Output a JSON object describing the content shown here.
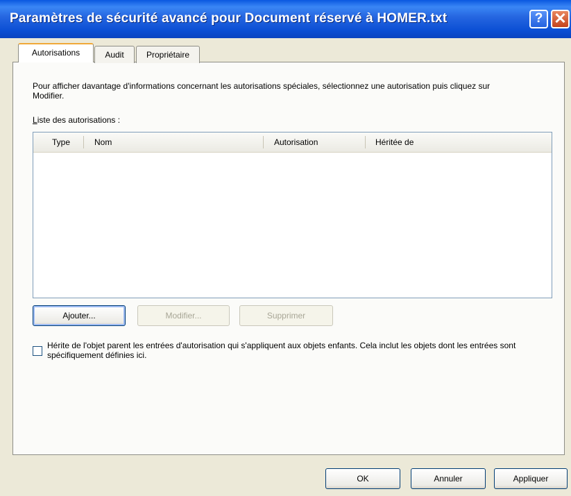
{
  "window": {
    "title": "Paramètres de sécurité avancé pour Document réservé à HOMER.txt",
    "help_glyph": "?",
    "close_glyph": "✕"
  },
  "tabs": [
    {
      "label": "Autorisations",
      "active": true
    },
    {
      "label": "Audit",
      "active": false
    },
    {
      "label": "Propriétaire",
      "active": false
    }
  ],
  "description": "Pour afficher davantage d'informations concernant les autorisations spéciales, sélectionnez une autorisation puis cliquez sur Modifier.",
  "list": {
    "label_mnemonic": "L",
    "label_rest": "iste des autorisations :",
    "columns": [
      "Type",
      "Nom",
      "Autorisation",
      "Héritée de"
    ],
    "rows": []
  },
  "buttons": {
    "add": "Ajouter...",
    "edit": "Modifier...",
    "delete": "Supprimer",
    "ok": "OK",
    "cancel": "Annuler",
    "apply": "Appliquer"
  },
  "inherit_checkbox": {
    "checked": false,
    "label": "Hérite de l'objet parent les entrées d'autorisation qui s'appliquent aux objets enfants. Cela inclut les objets dont les entrées sont spécifiquement définies ici."
  },
  "colors": {
    "titlebar": "#0b4fd4",
    "dialog_bg": "#ece9d8",
    "active_tab_accent": "#f0a838"
  }
}
